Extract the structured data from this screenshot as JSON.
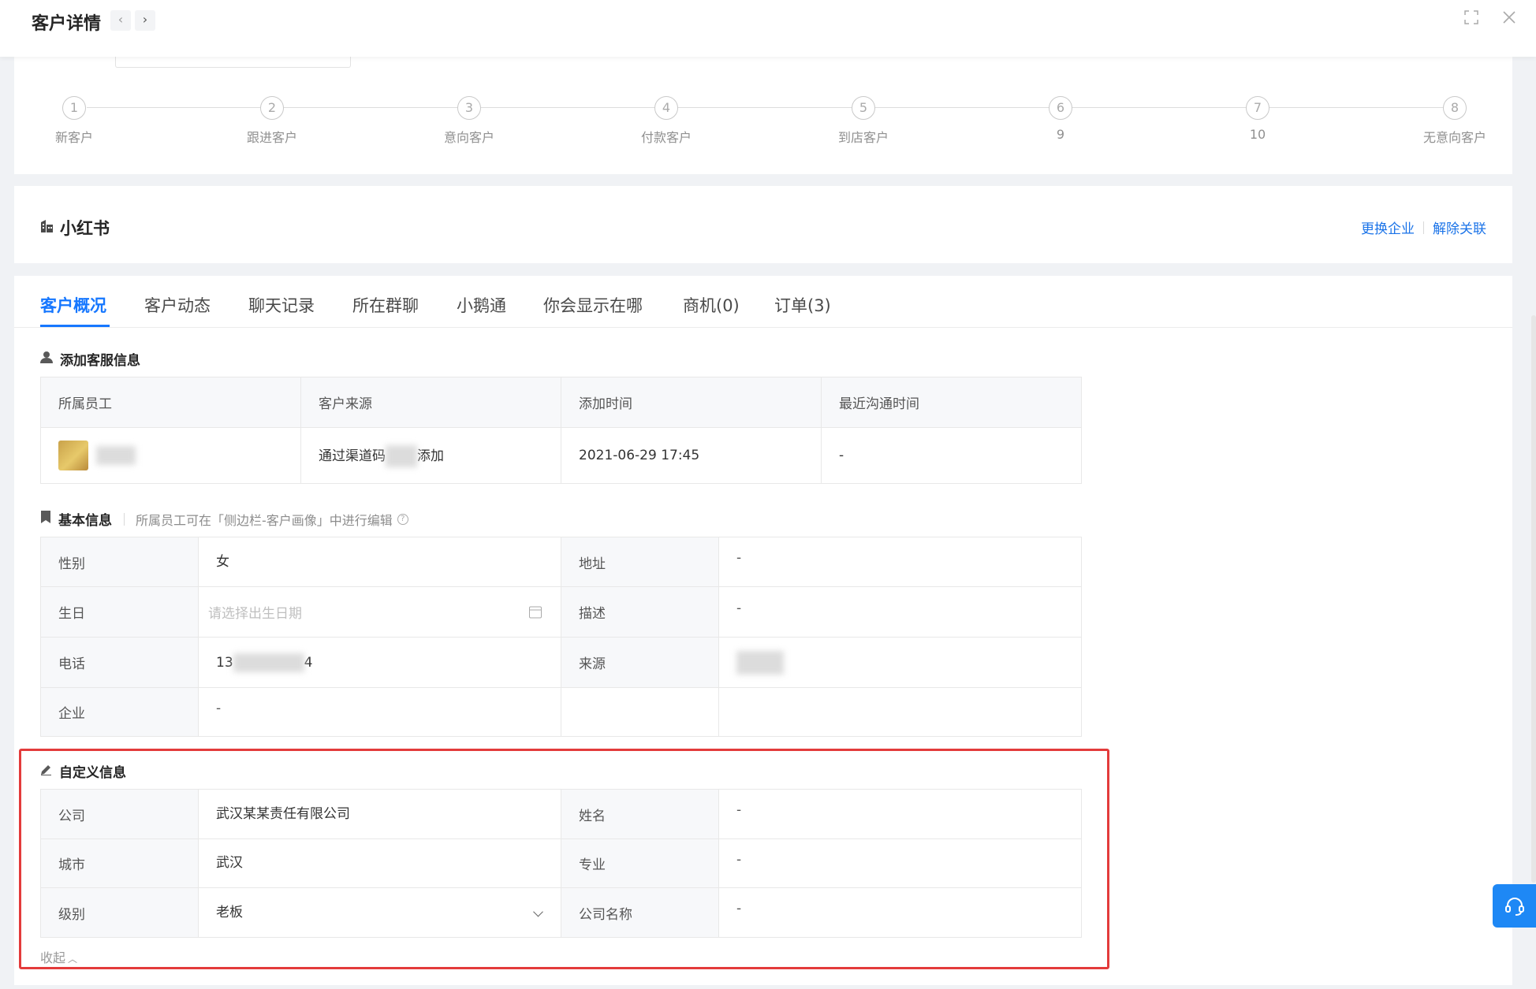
{
  "header": {
    "title": "客户详情",
    "prev_icon": "chevron-left-icon",
    "next_icon": "chevron-right-icon",
    "expand_icon": "expand-icon",
    "close_icon": "close-icon"
  },
  "steps": [
    {
      "num": "1",
      "label": "新客户"
    },
    {
      "num": "2",
      "label": "跟进客户"
    },
    {
      "num": "3",
      "label": "意向客户"
    },
    {
      "num": "4",
      "label": "付款客户"
    },
    {
      "num": "5",
      "label": "到店客户"
    },
    {
      "num": "6",
      "label": "9"
    },
    {
      "num": "7",
      "label": "10"
    },
    {
      "num": "8",
      "label": "无意向客户"
    }
  ],
  "company": {
    "name": "小红书",
    "icon": "building-icon",
    "change_label": "更换企业",
    "unlink_label": "解除关联"
  },
  "tabs": [
    "客户概况",
    "客户动态",
    "聊天记录",
    "所在群聊",
    "小鹅通",
    "你会显示在哪",
    "商机(0)",
    "订单(3)"
  ],
  "active_tab": "客户概况",
  "service": {
    "heading": "添加客服信息",
    "columns": [
      "所属员工",
      "客户来源",
      "添加时间",
      "最近沟通时间"
    ],
    "row": {
      "source_prefix": "通过渠道码",
      "source_suffix": "添加",
      "added_time": "2021-06-29 17:45",
      "last_contact": "-"
    }
  },
  "basic": {
    "heading": "基本信息",
    "note": "所属员工可在「侧边栏-客户画像」中进行编辑",
    "gender_label": "性别",
    "gender": "女",
    "address_label": "地址",
    "address": "-",
    "birthday_label": "生日",
    "birthday_placeholder": "请选择出生日期",
    "desc_label": "描述",
    "desc": "-",
    "phone_label": "电话",
    "phone_prefix": "13",
    "phone_suffix": "4",
    "origin_label": "来源",
    "company_label": "企业",
    "company": "-"
  },
  "custom": {
    "heading": "自定义信息",
    "company_label": "公司",
    "company": "武汉某某责任有限公司",
    "name_label": "姓名",
    "name": "-",
    "city_label": "城市",
    "city": "武汉",
    "major_label": "专业",
    "major": "-",
    "level_label": "级别",
    "level": "老板",
    "company_name_label": "公司名称",
    "company_name": "-",
    "collapse_label": "收起"
  },
  "colors": {
    "accent": "#1677ff",
    "highlight_box": "#e33b3b",
    "float_button": "#1e88f5"
  },
  "float_icon": "customer-service-icon"
}
